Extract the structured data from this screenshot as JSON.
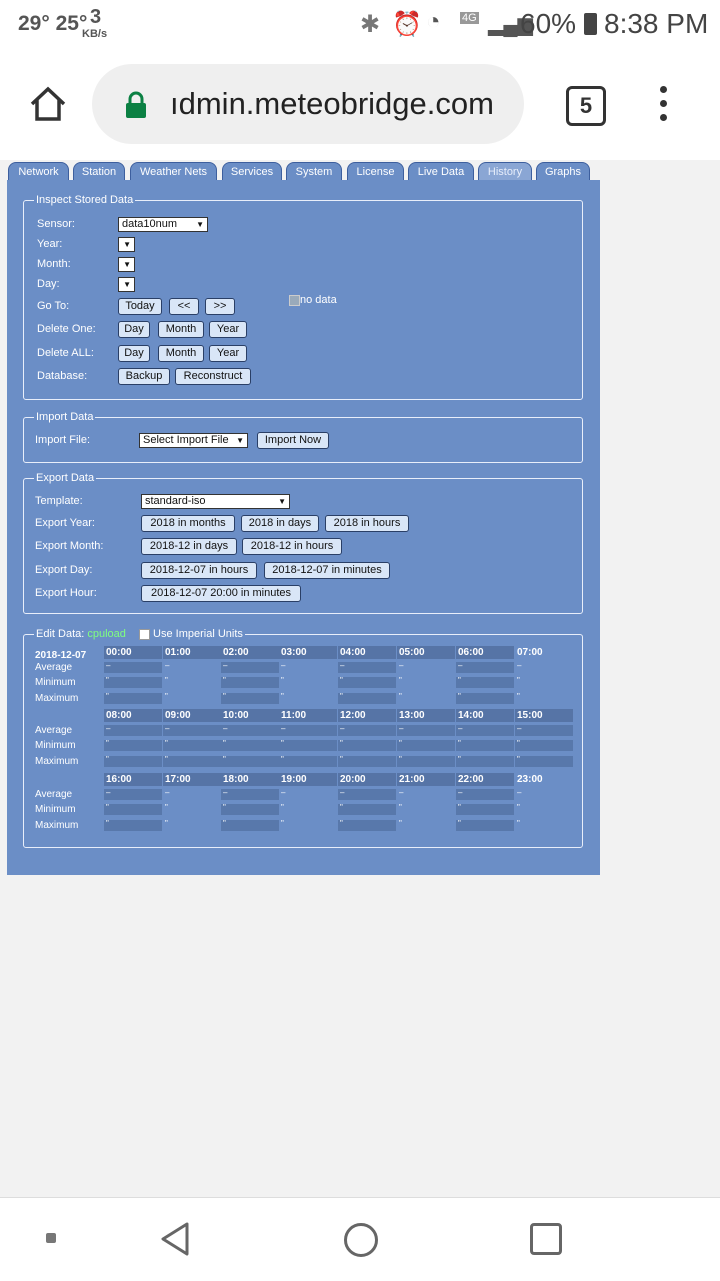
{
  "status": {
    "temps": "29° 25°",
    "speed": "3",
    "speed_unit": "KB/s",
    "network": "4G",
    "battery": "60%",
    "time": "8:38 PM"
  },
  "browser": {
    "url": "ıdmin.meteobridge.com",
    "tab_count": "5"
  },
  "nav_tabs": [
    "Network",
    "Station",
    "Weather Nets",
    "Services",
    "System",
    "License",
    "Live Data",
    "History",
    "Graphs"
  ],
  "inspect": {
    "legend": "Inspect Stored Data",
    "sensor_label": "Sensor:",
    "sensor_value": "data10num",
    "year_label": "Year:",
    "month_label": "Month:",
    "day_label": "Day:",
    "goto_label": "Go To:",
    "today": "Today",
    "prev": "<<",
    "next": ">>",
    "delete_one_label": "Delete One:",
    "delete_all_label": "Delete ALL:",
    "day": "Day",
    "month": "Month",
    "year": "Year",
    "database_label": "Database:",
    "backup": "Backup",
    "reconstruct": "Reconstruct",
    "no_data": "no data"
  },
  "import": {
    "legend": "Import Data",
    "file_label": "Import File:",
    "select_file": "Select Import File",
    "import_now": "Import Now"
  },
  "export": {
    "legend": "Export Data",
    "template_label": "Template:",
    "template_value": "standard-iso",
    "year_label": "Export Year:",
    "year_buttons": [
      "2018 in months",
      "2018 in days",
      "2018 in hours"
    ],
    "month_label": "Export Month:",
    "month_buttons": [
      "2018-12 in days",
      "2018-12 in hours"
    ],
    "day_label": "Export Day:",
    "day_buttons": [
      "2018-12-07 in hours",
      "2018-12-07 in minutes"
    ],
    "hour_label": "Export Hour:",
    "hour_buttons": [
      "2018-12-07 20:00 in minutes"
    ]
  },
  "edit": {
    "legend_prefix": "Edit Data:",
    "sensor": "cpuload",
    "imperial_label": "Use Imperial Units",
    "date": "2018-12-07",
    "row_labels": [
      "Average",
      "Minimum",
      "Maximum"
    ],
    "hours": [
      "00:00",
      "01:00",
      "02:00",
      "03:00",
      "04:00",
      "05:00",
      "06:00",
      "07:00",
      "08:00",
      "09:00",
      "10:00",
      "11:00",
      "12:00",
      "13:00",
      "14:00",
      "15:00",
      "16:00",
      "17:00",
      "18:00",
      "19:00",
      "20:00",
      "21:00",
      "22:00",
      "23:00"
    ],
    "avg_value": "–",
    "minmax_value": "\""
  },
  "colors": {
    "panel": "#6b8ec6",
    "accent_sensor": "#7fff7f"
  }
}
